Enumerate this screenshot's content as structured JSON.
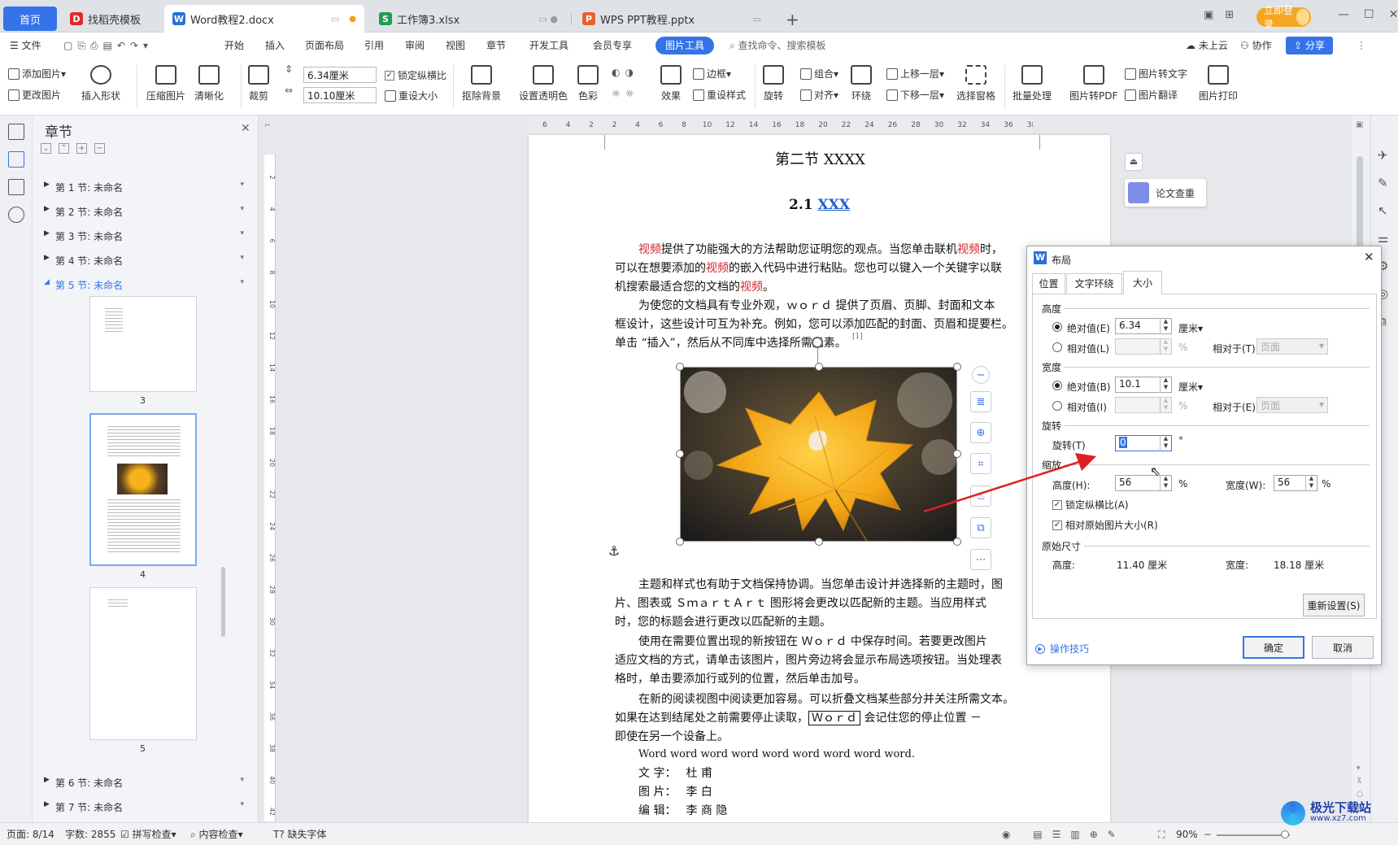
{
  "tabs": [
    {
      "label": "首页"
    },
    {
      "label": "找稻壳模板"
    },
    {
      "label": "Word教程2.docx"
    },
    {
      "label": "工作簿3.xlsx"
    },
    {
      "label": "WPS PPT教程.pptx"
    }
  ],
  "titlebar": {
    "login": "立即登录"
  },
  "menu": {
    "file": "文件",
    "items": [
      "开始",
      "插入",
      "页面布局",
      "引用",
      "审阅",
      "视图",
      "章节",
      "开发工具",
      "会员专享",
      "图片工具"
    ],
    "search": "查找命令、搜索模板",
    "cloud": "未上云",
    "collab": "协作",
    "share": "分享"
  },
  "ribbon": {
    "add_picture": "添加图片",
    "change_picture": "更改图片",
    "insert_shape": "插入形状",
    "compress": "压缩图片",
    "sharpen": "清晰化",
    "crop": "裁剪",
    "height_value": "6.34厘米",
    "width_value": "10.10厘米",
    "lock_ratio": "锁定纵横比",
    "reset_size": "重设大小",
    "remove_bg": "抠除背景",
    "set_transparent": "设置透明色",
    "color": "色彩",
    "effects": "效果",
    "border": "边框",
    "reset_style": "重设样式",
    "rotate": "旋转",
    "group": "组合",
    "align": "对齐",
    "wrap": "环绕",
    "bring_forward": "上移一层",
    "send_backward": "下移一层",
    "select_pane": "选择窗格",
    "batch": "批量处理",
    "to_pdf": "图片转PDF",
    "to_text": "图片转文字",
    "translate": "图片翻译",
    "print": "图片打印"
  },
  "chapter_panel": {
    "title": "章节",
    "sections": [
      {
        "label": "第 1 节: 未命名"
      },
      {
        "label": "第 2 节: 未命名"
      },
      {
        "label": "第 3 节: 未命名"
      },
      {
        "label": "第 4 节: 未命名"
      },
      {
        "label": "第 5 节: 未命名"
      },
      {
        "label": "第 6 节: 未命名"
      },
      {
        "label": "第 7 节: 未命名"
      }
    ],
    "page_numbers": [
      "3",
      "4",
      "5"
    ]
  },
  "ruler": {
    "h_ticks": [
      "6",
      "4",
      "2",
      "2",
      "4",
      "6",
      "8",
      "10",
      "12",
      "14",
      "16",
      "18",
      "20",
      "22",
      "24",
      "26",
      "28",
      "30",
      "32",
      "34",
      "36",
      "38",
      "40"
    ],
    "v_ticks": [
      "2",
      "4",
      "6",
      "8",
      "10",
      "12",
      "14",
      "16",
      "18",
      "20",
      "22",
      "24",
      "26",
      "28",
      "30",
      "32",
      "34",
      "36",
      "38",
      "40",
      "42"
    ]
  },
  "document": {
    "section_title": "第二节  XXXX",
    "heading_num": "2.1",
    "heading_link": "XXX",
    "p1": [
      [
        {
          "t": "视频",
          "red": true
        },
        {
          "t": "提供了功能强大的方法帮助您证明您的观点。当您单击联机"
        },
        {
          "t": "视频",
          "red": true
        },
        {
          "t": "时，"
        }
      ],
      [
        {
          "t": "可以在想要添加的"
        },
        {
          "t": "视频",
          "red": true
        },
        {
          "t": "的嵌入代码中进行粘贴。您也可以键入一个关键字以联"
        }
      ],
      [
        {
          "t": "机搜索最适合您的文档的"
        },
        {
          "t": "视频",
          "red": true
        },
        {
          "t": "。"
        }
      ]
    ],
    "p2": [
      "为使您的文档具有专业外观，ｗｏｒｄ  提供了页眉、页脚、封面和文本",
      "框设计，这些设计可互为补充。例如，您可以添加匹配的封面、页眉和提要栏。",
      "单击 “插入”，然后从不同库中选择所需元素。"
    ],
    "footnote_mark": "[1]",
    "p3": [
      "主题和样式也有助于文档保持协调。当您单击设计并选择新的主题时，图",
      "片、图表或  ＳｍａｒｔＡｒｔ  图形将会更改以匹配新的主题。当应用样式",
      "时，您的标题会进行更改以匹配新的主题。"
    ],
    "p4": [
      "使用在需要位置出现的新按钮在  Ｗｏｒｄ  中保存时间。若要更改图片",
      "适应文档的方式，请单击该图片，图片旁边将会显示布局选项按钮。当处理表",
      "格时，单击要添加行或列的位置，然后单击加号。"
    ],
    "p5a": "在新的阅读视图中阅读更加容易。可以折叠文档某些部分并关注所需文本。",
    "p5b_pre": "如果在达到结尾处之前需要停止读取，",
    "p5b_box": "Ｗｏｒｄ",
    "p5b_post": "  会记住您的停止位置  －",
    "p5c": "即使在另一个设备上。",
    "word_line": "Word word word word word word word word word.",
    "credits": [
      {
        "k": "文 字：",
        "v": "杜    甫"
      },
      {
        "k": "图 片：",
        "v": "李    白"
      },
      {
        "k": "编 辑：",
        "v": "李 商 隐"
      }
    ]
  },
  "side_panel": {
    "thesis_check": "论文查重"
  },
  "dialog": {
    "title": "布局",
    "tabs": [
      "位置",
      "文字环绕",
      "大小"
    ],
    "height": {
      "group": "高度",
      "absolute_label": "绝对值(E)",
      "absolute_value": "6.34",
      "unit": "厘米",
      "relative_label": "相对值(L)",
      "relative_to_label": "相对于(T)",
      "relative_to_value": "页面"
    },
    "width": {
      "group": "宽度",
      "absolute_label": "绝对值(B)",
      "absolute_value": "10.1",
      "unit": "厘米",
      "relative_label": "相对值(I)",
      "relative_to_label": "相对于(E)",
      "relative_to_value": "页面"
    },
    "percent": "%",
    "rotate": {
      "group": "旋转",
      "label": "旋转(T)",
      "value": "0",
      "unit": "°"
    },
    "scale": {
      "group": "缩放",
      "height_label": "高度(H):",
      "height_value": "56",
      "width_label": "宽度(W):",
      "width_value": "56",
      "lock_ratio": "锁定纵横比(A)",
      "relative_original": "相对原始图片大小(R)"
    },
    "original": {
      "group": "原始尺寸",
      "height_label": "高度:",
      "height_value": "11.40 厘米",
      "width_label": "宽度:",
      "width_value": "18.18 厘米",
      "reset": "重新设置(S)"
    },
    "tips": "操作技巧",
    "ok": "确定",
    "cancel": "取消"
  },
  "status": {
    "page": "页面: 8/14",
    "words": "字数: 2855",
    "spell": "拼写检查",
    "content": "内容检查",
    "missing_font": "缺失字体",
    "zoom": "90%"
  },
  "watermark": "极光下载站",
  "watermark_url": "www.xz7.com"
}
